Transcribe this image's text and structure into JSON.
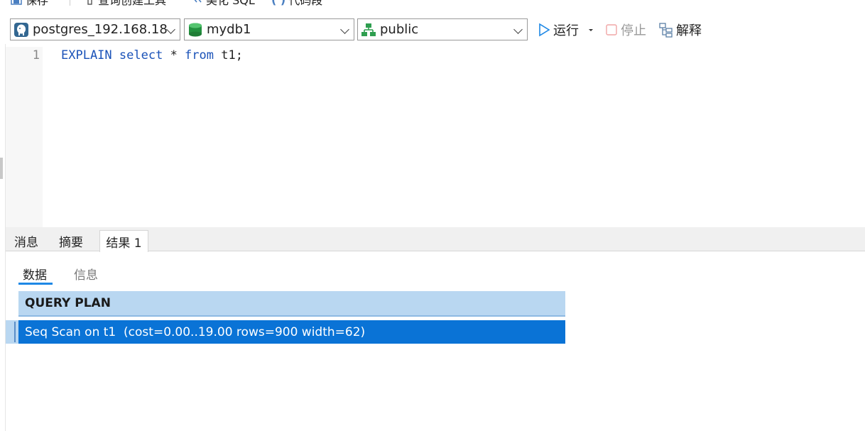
{
  "top_toolbar": {
    "save_label": "保存",
    "query_builder_label": "查询创建工具",
    "beautify_label": "美化 SQL",
    "snippet_label": "代码段"
  },
  "connection_bar": {
    "connection": "postgres_192.168.18",
    "database": "mydb1",
    "schema": "public",
    "run_label": "运行",
    "stop_label": "停止",
    "explain_label": "解释"
  },
  "editor": {
    "lines": [
      {
        "number": "1",
        "keyword1": "EXPLAIN",
        "keyword2": "select",
        "star": " * ",
        "keyword3": "from",
        "rest": " t1;"
      }
    ]
  },
  "result_tabs": {
    "messages": "消息",
    "summary": "摘要",
    "result1": "结果 1"
  },
  "sub_tabs": {
    "data": "数据",
    "info": "信息"
  },
  "grid": {
    "header": "QUERY PLAN",
    "rows": [
      "Seq Scan on t1  (cost=0.00..19.00 rows=900 width=62)"
    ]
  },
  "colors": {
    "keyword": "#1a52b8",
    "selected_row": "#0a73d6",
    "header_bg": "#b9d7f1",
    "accent": "#1e88e5"
  }
}
